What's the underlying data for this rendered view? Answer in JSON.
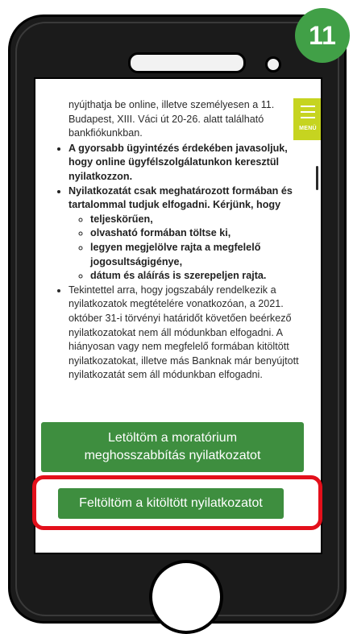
{
  "step_badge": "11",
  "menu": {
    "label": "MENÜ"
  },
  "content": {
    "intro": "nyújthatja be online, illetve személyesen a 11. Budapest, XIII. Váci út 20-26. alatt található bankfiókunkban.",
    "bullets": [
      "A gyorsabb ügyintézés érdekében javasoljuk, hogy online ügyfélszolgálatunkon keresztül nyilatkozzon.",
      "Nyilatkozatát csak meghatározott formában és tartalommal tudjuk elfogadni. Kérjünk, hogy"
    ],
    "sub_bullets": [
      "teljeskörűen,",
      "olvasható formában töltse ki,",
      "legyen megjelölve rajta a megfelelő jogosultságigénye,",
      "dátum és aláírás is szerepeljen rajta."
    ],
    "last_bullet": "Tekintettel arra, hogy jogszabály rendelkezik a nyilatkozatok megtételére vonatkozóan, a 2021. október 31-i törvényi határidőt követően beérkező nyilatkozatokat nem áll módunkban elfogadni. A hiányosan vagy nem megfelelő formában kitöltött nyilatkozatokat, illetve más Banknak már benyújtott nyilatkozatát sem áll módunkban elfogadni."
  },
  "buttons": {
    "download_line1": "Letöltöm a moratórium",
    "download_line2": "meghosszabbítás nyilatkozatot",
    "upload": "Feltöltöm a kitöltött nyilatkozatot"
  },
  "colors": {
    "button_green": "#3e8e3f",
    "menu_lime": "#c6d420",
    "highlight_red": "#e3101b",
    "badge_green": "#41a047"
  }
}
